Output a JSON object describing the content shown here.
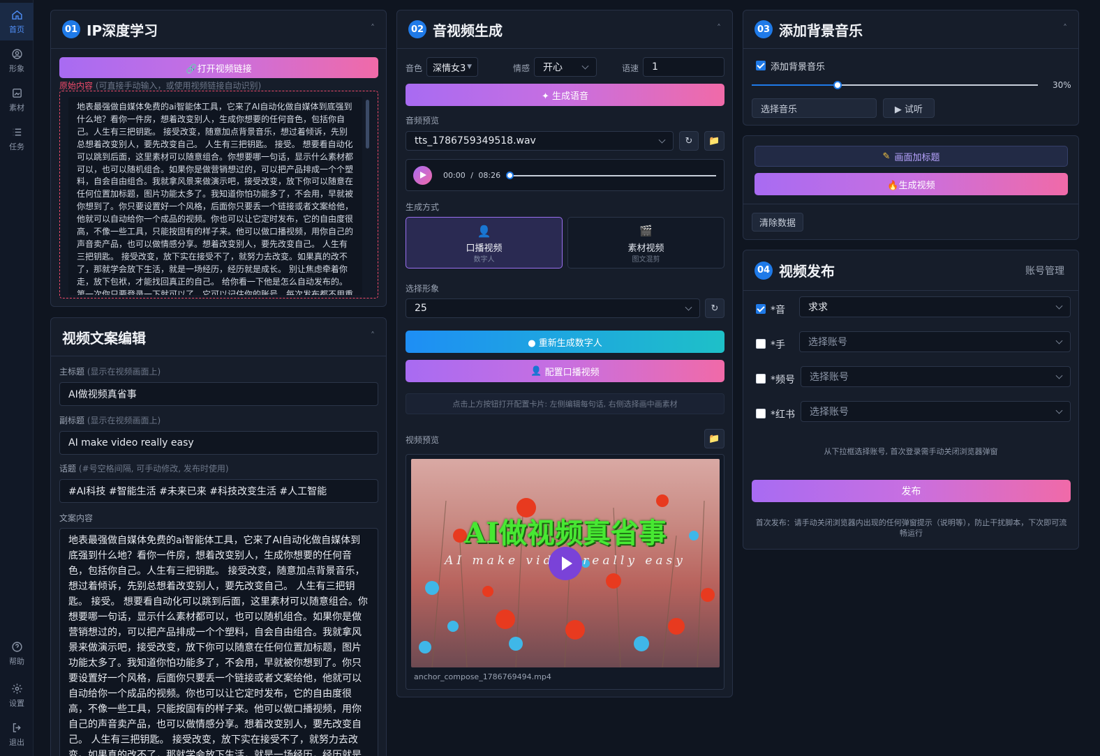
{
  "nav": {
    "top": [
      {
        "label": "首页",
        "icon": "home-icon"
      },
      {
        "label": "形象",
        "icon": "avatar-icon"
      },
      {
        "label": "素材",
        "icon": "image-icon"
      },
      {
        "label": "任务",
        "icon": "list-icon"
      }
    ],
    "bottom": [
      {
        "label": "帮助",
        "icon": "help-icon"
      },
      {
        "label": "设置",
        "icon": "gear-icon"
      },
      {
        "label": "退出",
        "icon": "logout-icon"
      }
    ]
  },
  "panel1": {
    "num": "01",
    "title": "IP深度学习",
    "open_link_button": "🔗打开视频链接",
    "source_label": "原始内容",
    "source_hint": "(可直接手动输入，或使用视频链接自动识别)",
    "source_text": "地表最强做自媒体免费的ai智能体工具，它来了AI自动化做自媒体到底强到什么地？看你一件房，想着改变别人，生成你想要的任何音色，包括你自己。人生有三把钥匙。 接受改变，随意加点背景音乐，想过着倾诉，先别总想着改变别人，要先改变自己。 人生有三把钥匙。 接受。 想要看自动化可以跳到后面，这里素材可以随意组合。你想要哪一句话，显示什么素材都可以，也可以随机组合。如果你是做营销想过的，可以把产品排成一个个塑料，自会自由组合。我就拿风景来做演示吧，接受改变，放下你可以随意在任何位置加标题，图片功能太多了。我知道你怕功能多了，不会用，早就被你想到了。你只要设置好一个风格，后面你只要丢一个链接或者文案给他，他就可以自动给你一个成品的视频。你也可以让它定时发布，它的自由度很高，不像一些工具，只能按固有的样子来。他可以做口播视频，用你自己的声音卖产品，也可以做情感分享。想着改变别人，要先改变自己。 人生有三把钥匙。 接受改变，放下实在接受不了，就努力去改变。如果真的改不了，那就学会放下生活，就是一场经历，经历就是成长。 别让焦虑牵着你走，放下包袱，才能找回真正的自己。 给你看一下他是怎么自动发布的。第一次你只要登录一下就可以了，它可以记住你的账号，每次发布都不用重新登录，自动发布就这么简单。"
  },
  "panel_copy": {
    "title": "视频文案编辑",
    "main_title_label": "主标题",
    "main_title_hint": "(显示在视频画面上)",
    "main_title_value": "AI做视频真省事",
    "sub_title_label": "副标题",
    "sub_title_hint": "(显示在视频画面上)",
    "sub_title_value": "AI make video really easy",
    "topic_label": "话题",
    "topic_hint": "(#号空格间隔, 可手动修改, 发布时使用)",
    "topic_value": "#AI科技 #智能生活 #未来已来 #科技改变生活 #人工智能",
    "content_label": "文案内容",
    "content_text": "地表最强做自媒体免费的ai智能体工具，它来了AI自动化做自媒体到底强到什么地？看你一件房，想着改变别人，生成你想要的任何音色，包括你自己。人生有三把钥匙。 接受改变，随意加点背景音乐，想过着倾诉，先别总想着改变别人，要先改变自己。 人生有三把钥匙。 接受。 想要看自动化可以跳到后面，这里素材可以随意组合。你想要哪一句话，显示什么素材都可以，也可以随机组合。如果你是做营销想过的，可以把产品排成一个个塑料，自会自由组合。我就拿风景来做演示吧，接受改变，放下你可以随意在任何位置加标题，图片功能太多了。我知道你怕功能多了，不会用，早就被你想到了。你只要设置好一个风格，后面你只要丢一个链接或者文案给他，他就可以自动给你一个成品的视频。你也可以让它定时发布，它的自由度很高，不像一些工具，只能按固有的样子来。他可以做口播视频，用你自己的声音卖产品，也可以做情感分享。想着改变别人，要先改变自己。 人生有三把钥匙。 接受改变，放下实在接受不了，就努力去改变。如果真的改不了，那就学会放下生活，就是一场经历，经历就是成长。 别让"
  },
  "panel2": {
    "num": "02",
    "title": "音视频生成",
    "voice_label": "音色",
    "voice_value": "深情女3",
    "emotion_label": "情感",
    "emotion_value": "开心",
    "speed_label": "语速",
    "speed_value": "1",
    "gen_voice_button": "✦ 生成语音",
    "audio_preview_label": "音频预览",
    "audio_file": "tts_1786759349518.wav",
    "time_current": "00:00",
    "time_sep": "/",
    "time_total": "08:26",
    "mode_label": "生成方式",
    "mode_talk": "口播视频",
    "mode_talk_sub": "数字人",
    "mode_material": "素材视频",
    "mode_material_sub": "图文混剪",
    "avatar_label": "选择形象",
    "avatar_value": "25",
    "regen_button": "● 重新生成数字人",
    "config_button": "配置口播视频",
    "config_hint": "点击上方按钮打开配置卡片: 左侧编辑每句话, 右侧选择画中画素材",
    "video_preview_label": "视频预览",
    "video_title": "AI做视频真省事",
    "video_sub": "AI make video really easy",
    "video_file": "anchor_compose_1786769494.mp4"
  },
  "panel3": {
    "num": "03",
    "title": "添加背景音乐",
    "bgm_checkbox": "添加背景音乐",
    "bgm_checked": true,
    "volume": 30,
    "volume_text": "30%",
    "select_music": "选择音乐",
    "listen_button": "▶ 试听"
  },
  "panel_actions": {
    "add_title_button": "画面加标题",
    "gen_video_button": "🔥生成视频",
    "clear_button": "清除数据"
  },
  "panel4": {
    "num": "04",
    "title": "视频发布",
    "account_manage": "账号管理",
    "platforms": [
      {
        "label": "*音",
        "checked": true,
        "value": "求求",
        "placeholder": ""
      },
      {
        "label": "*手",
        "checked": false,
        "value": "",
        "placeholder": "选择账号"
      },
      {
        "label": "*频号",
        "checked": false,
        "value": "",
        "placeholder": "选择账号"
      },
      {
        "label": "*红书",
        "checked": false,
        "value": "",
        "placeholder": "选择账号"
      }
    ],
    "account_hint": "从下拉框选择账号, 首次登录需手动关闭浏览器弹窗",
    "publish_button": "发布",
    "footer_note": "首次发布：请手动关闭浏览器内出现的任何弹窗提示（说明等），防止干扰脚本，下次即可流畅运行"
  },
  "colors": {
    "accent": "#1f7ae8",
    "gradient_start": "#a86bf2",
    "gradient_end": "#f06aa8",
    "cyan_start": "#1e8ef5",
    "cyan_end": "#1ec0c8",
    "source_red": "#ef4a6a"
  }
}
